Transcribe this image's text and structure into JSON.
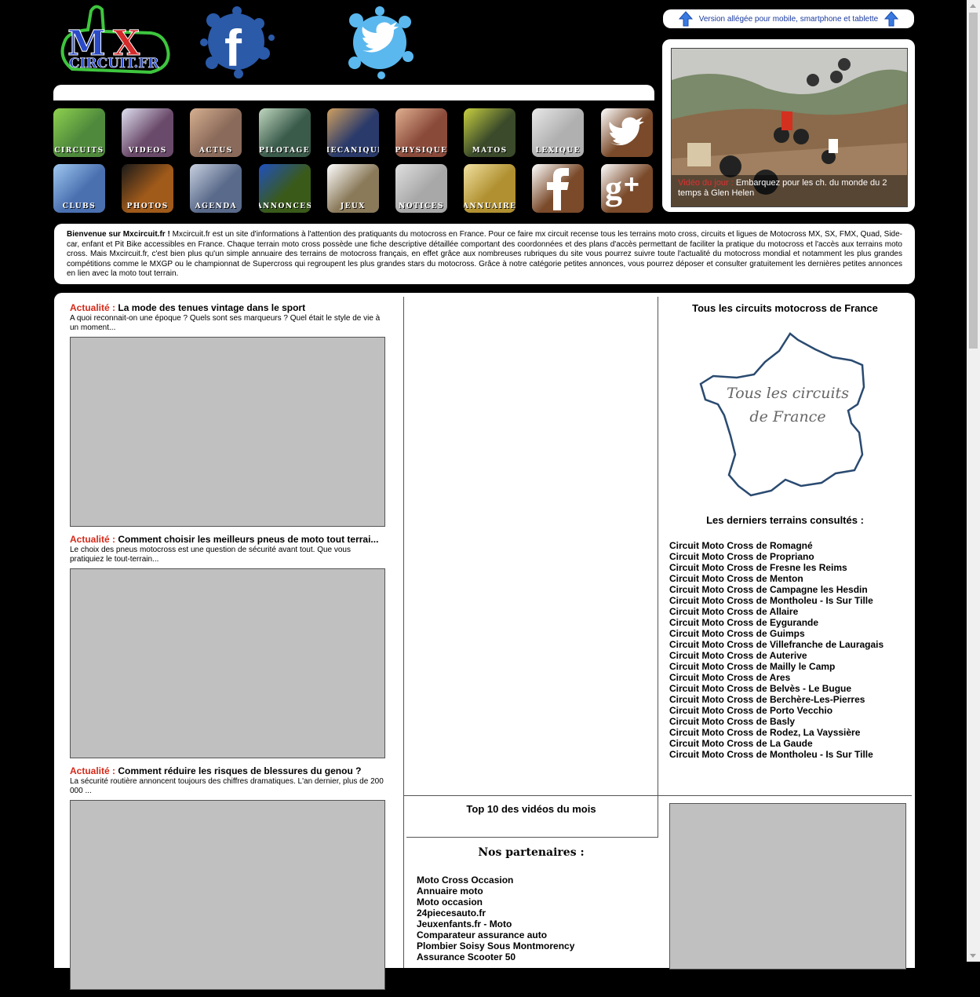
{
  "header": {
    "logo_text_top": "MX",
    "logo_text_bottom": "CIRCUIT.FR",
    "facebook_letter": "f",
    "mobile_link": "Version allégée pour mobile, smartphone et tablette"
  },
  "nav_tiles": [
    {
      "label": "CIRCUITS",
      "bg": "#4f8a3c",
      "accent": "#8fd14f"
    },
    {
      "label": "VIDEOS",
      "bg": "#6a4a6a",
      "accent": "#e0e0f0"
    },
    {
      "label": "ACTUS",
      "bg": "#8a6a5a",
      "accent": "#d6b090"
    },
    {
      "label": "PILOTAGE",
      "bg": "#3a5a4a",
      "accent": "#c0d8c0"
    },
    {
      "label": "MECANIQUE",
      "bg": "#2a3a6a",
      "accent": "#d0a060"
    },
    {
      "label": "PHYSIQUE",
      "bg": "#8a4a3a",
      "accent": "#e0b090"
    },
    {
      "label": "MATOS",
      "bg": "#3a4a2a",
      "accent": "#c8d040"
    },
    {
      "label": "LEXIQUE",
      "bg": "#b0b0b0",
      "accent": "#e8e8e8"
    },
    {
      "label": "",
      "bg": "#7a4a2a",
      "accent": "#ffffff"
    },
    {
      "label": "CLUBS",
      "bg": "#4a70b0",
      "accent": "#a0c8f0"
    },
    {
      "label": "PHOTOS",
      "bg": "#a05a1a",
      "accent": "#1a1a1a"
    },
    {
      "label": "AGENDA",
      "bg": "#5a6a8a",
      "accent": "#c8d0e0"
    },
    {
      "label": "ANNONCES",
      "bg": "#3a5a1a",
      "accent": "#2050c0"
    },
    {
      "label": "JEUX",
      "bg": "#8a7a5a",
      "accent": "#ffffff"
    },
    {
      "label": "NOTICES",
      "bg": "#a8a8a8",
      "accent": "#e0e0e0"
    },
    {
      "label": "ANNUAIRE",
      "bg": "#b09030",
      "accent": "#f0e0a0"
    },
    {
      "label": "",
      "bg": "#7a4a2a",
      "accent": "#ffffff"
    },
    {
      "label": "",
      "bg": "#7a4a2a",
      "accent": "#ffffff"
    }
  ],
  "video": {
    "tag": "Vidéo du jour :",
    "caption": "Embarquez pour les ch. du monde du 2 temps à Glen Helen"
  },
  "intro": {
    "lead": "Bienvenue sur Mxcircuit.fr !",
    "text": " Mxcircuit.fr est un site d'informations à l'attention des pratiquants du motocross en France. Pour ce faire mx circuit recense tous les terrains moto cross, circuits et ligues de Motocross MX, SX, FMX, Quad, Side-car, enfant et Pit Bike accessibles en France. Chaque terrain moto cross possède une fiche descriptive détaillée comportant des coordonnées et des plans d'accès permettant de faciliter la pratique du motocross et l'accès aux terrains moto cross. Mais Mxcircuit.fr, c'est bien plus qu'un simple annuaire des terrains de motocross français, en effet grâce aux nombreuses rubriques du site vous pourrez suivre toute l'actualité du motocross mondial et notamment les plus grandes compétitions comme le MXGP ou le championnat de Supercross qui regroupent les plus grandes stars du motocross. Grâce à notre catégorie petites annonces, vous pourrez déposer et consulter gratuitement les dernières petites annonces en lien avec la moto tout terrain."
  },
  "articles": [
    {
      "tag": "Actualité :",
      "title": "La mode des tenues vintage dans le sport",
      "desc": "A quoi reconnait-on une époque ? Quels sont ses marqueurs ? Quel était le style de vie à un moment..."
    },
    {
      "tag": "Actualité :",
      "title": "Comment choisir les meilleurs pneus de moto tout terrai...",
      "desc": "Le choix des pneus motocross est une question de sécurité avant tout. Que vous pratiquiez le tout-terrain..."
    },
    {
      "tag": "Actualité :",
      "title": "Comment réduire les risques de blessures du genou ?",
      "desc": "La sécurité routière annoncent toujours des chiffres dramatiques. L'an dernier, plus de 200 000 ..."
    }
  ],
  "right": {
    "title": "Tous les circuits motocross de France",
    "map_text_1": "Tous les circuits",
    "map_text_2": "de France",
    "recent_title": "Les derniers terrains consultés :",
    "terrains": [
      "Circuit Moto Cross de Romagné",
      "Circuit Moto Cross de Propriano",
      "Circuit Moto Cross de Fresne les Reims",
      "Circuit Moto Cross de Menton",
      "Circuit Moto Cross de Campagne les Hesdin",
      "Circuit Moto Cross de Montholeu - Is Sur Tille",
      "Circuit Moto Cross de Allaire",
      "Circuit Moto Cross de Eygurande",
      "Circuit Moto Cross de Guimps",
      "Circuit Moto Cross de Villefranche de Lauragais",
      "Circuit Moto Cross de Auterive",
      "Circuit Moto Cross de Mailly le Camp",
      "Circuit Moto Cross de Ares",
      "Circuit Moto Cross de Belvès - Le Bugue",
      "Circuit Moto Cross de Berchère-Les-Pierres",
      "Circuit Moto Cross de Porto Vecchio",
      "Circuit Moto Cross de Basly",
      "Circuit Moto Cross de Rodez, La Vayssière",
      "Circuit Moto Cross de La Gaude",
      "Circuit Moto Cross de Montholeu - Is Sur Tille"
    ]
  },
  "middle": {
    "top10": "Top 10 des vidéos du mois",
    "partners_title": "Nos partenaires :",
    "partners": [
      "Moto Cross Occasion",
      "Annuaire moto",
      "Moto occasion",
      "24piecesauto.fr",
      "Jeuxenfants.fr - Moto",
      "Comparateur assurance auto",
      "Plombier Soisy Sous Montmorency",
      "Assurance Scooter 50"
    ]
  }
}
